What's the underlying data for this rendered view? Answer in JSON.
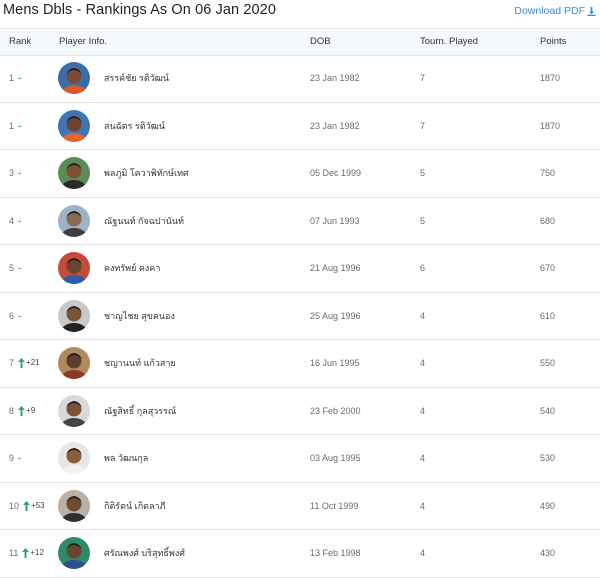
{
  "page": {
    "title": "Mens Dbls - Rankings As On 06 Jan 2020",
    "download_label": "Download PDF"
  },
  "table": {
    "columns": [
      "Rank",
      "Player Info.",
      "DOB",
      "Tourn. Played",
      "Points"
    ],
    "rows": [
      {
        "rank": "1",
        "change": "-",
        "name": "สรรค์ชัย รติวัฒน์",
        "dob": "23 Jan 1982",
        "tourn": "7",
        "points": "1870",
        "av": [
          "#3b6ea8",
          "#d65a2a",
          "#7a4b32"
        ]
      },
      {
        "rank": "1",
        "change": "-",
        "name": "สนฉัตร รติวัฒน์",
        "dob": "23 Jan 1982",
        "tourn": "7",
        "points": "1870",
        "av": [
          "#3f76b3",
          "#e0662e",
          "#6f4430"
        ]
      },
      {
        "rank": "3",
        "change": "-",
        "name": "พลภูมิ โควาพิทักษ์เทศ",
        "dob": "05 Dec 1999",
        "tourn": "5",
        "points": "750",
        "av": [
          "#5a8c5a",
          "#2b2b2b",
          "#7c5236"
        ]
      },
      {
        "rank": "4",
        "change": "-",
        "name": "ณัฐนนท์ กัจฉปานันท์",
        "dob": "07 Jun 1993",
        "tourn": "5",
        "points": "680",
        "av": [
          "#9fb3c8",
          "#3d3d3d",
          "#8a6a4e"
        ]
      },
      {
        "rank": "5",
        "change": "-",
        "name": "คงทรัพย์ คงคา",
        "dob": "21 Aug 1996",
        "tourn": "6",
        "points": "670",
        "av": [
          "#c44a3a",
          "#2a5fa8",
          "#6b4330"
        ]
      },
      {
        "rank": "6",
        "change": "-",
        "name": "ชาญไชย สุขคนอง",
        "dob": "25 Aug 1996",
        "tourn": "4",
        "points": "610",
        "av": [
          "#c9c9c9",
          "#222222",
          "#7b5338"
        ]
      },
      {
        "rank": "7",
        "change": "+21",
        "name": "ชญานนท์ แก้วสาย",
        "dob": "16 Jun 1995",
        "tourn": "4",
        "points": "550",
        "av": [
          "#b08a5c",
          "#8a3a2a",
          "#5e3e2c"
        ]
      },
      {
        "rank": "8",
        "change": "+9",
        "name": "ณัฐสิทธิ์ กุลสุวรรณ์",
        "dob": "23 Feb 2000",
        "tourn": "4",
        "points": "540",
        "av": [
          "#d8d8d8",
          "#444444",
          "#7a5235"
        ]
      },
      {
        "rank": "9",
        "change": "-",
        "name": "พล วัฒนกุล",
        "dob": "03 Aug 1995",
        "tourn": "4",
        "points": "530",
        "av": [
          "#e6e6e6",
          "#f2f2f2",
          "#8b5e3c"
        ]
      },
      {
        "rank": "10",
        "change": "+53",
        "name": "กิติรัตน์ เกิดลาภี",
        "dob": "11 Oct 1999",
        "tourn": "4",
        "points": "490",
        "av": [
          "#b9b1a8",
          "#2f2f2f",
          "#6e4a34"
        ]
      },
      {
        "rank": "11",
        "change": "+12",
        "name": "ศรัณพงศ์ บริสุทธิ์พงศ์",
        "dob": "13 Feb 1998",
        "tourn": "4",
        "points": "430",
        "av": [
          "#2f8a6a",
          "#2b4f8f",
          "#6a4530"
        ]
      }
    ]
  },
  "colors": {
    "link": "#3a8fd6",
    "header_bg": "#f3f8fc",
    "dash_green": "#2aa876",
    "arrow_green": "#2aa876"
  },
  "icons": {
    "download": "download-icon",
    "rank_up": "arrow-up-icon",
    "avatar": "player-avatar"
  }
}
